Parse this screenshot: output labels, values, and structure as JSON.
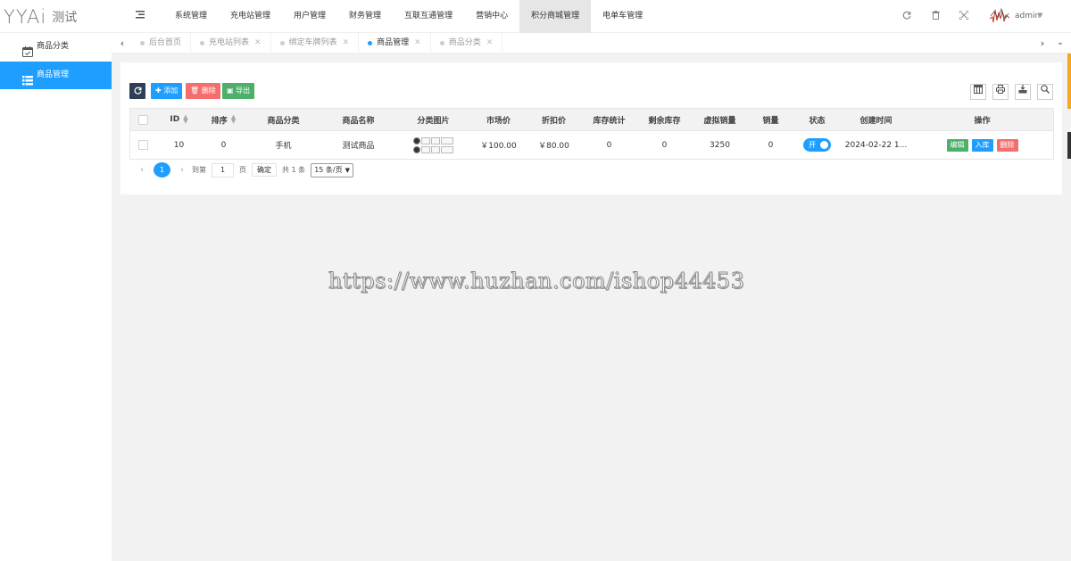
{
  "app": {
    "logo_mark": "YYAi",
    "logo_text": "测试"
  },
  "nav": {
    "items": [
      "系统管理",
      "充电站管理",
      "用户管理",
      "财务管理",
      "互联互通管理",
      "营销中心",
      "积分商城管理",
      "电单车管理"
    ],
    "active_index": 6
  },
  "header": {
    "user_name": "admin"
  },
  "sidebar": {
    "items": [
      {
        "label": "商品分类",
        "icon": "calendar-check-icon"
      },
      {
        "label": "商品管理",
        "icon": "list-icon"
      }
    ],
    "active_index": 1
  },
  "tabs": [
    {
      "label": "后台首页",
      "closable": false
    },
    {
      "label": "充电站列表",
      "closable": true
    },
    {
      "label": "绑定车牌列表",
      "closable": true
    },
    {
      "label": "商品管理",
      "closable": true,
      "active": true
    },
    {
      "label": "商品分类",
      "closable": true
    }
  ],
  "toolbar": {
    "add_label": "添加",
    "delete_label": "删除",
    "export_label": "导出"
  },
  "table": {
    "columns": [
      "ID",
      "排序",
      "商品分类",
      "商品名称",
      "分类图片",
      "市场价",
      "折扣价",
      "库存统计",
      "剩余库存",
      "虚拟销量",
      "销量",
      "状态",
      "创建时间",
      "操作"
    ],
    "rows": [
      {
        "id": "10",
        "sort": "0",
        "category": "手机",
        "name": "测试商品",
        "market_price": "￥100.00",
        "discount_price": "￥80.00",
        "stock_total": "0",
        "stock_left": "0",
        "virtual_sales": "3250",
        "sales": "0",
        "status_label": "开",
        "created": "2024-02-22 1...",
        "actions": {
          "edit": "编辑",
          "stock_in": "入库",
          "delete": "删除"
        }
      }
    ]
  },
  "pager": {
    "current": "1",
    "goto_label": "到第",
    "goto_value": "1",
    "page_unit": "页",
    "ok_label": "确定",
    "total_label": "共 1 条",
    "page_size_label": "15 条/页"
  },
  "watermark": "https://www.huzhan.com/ishop44453"
}
